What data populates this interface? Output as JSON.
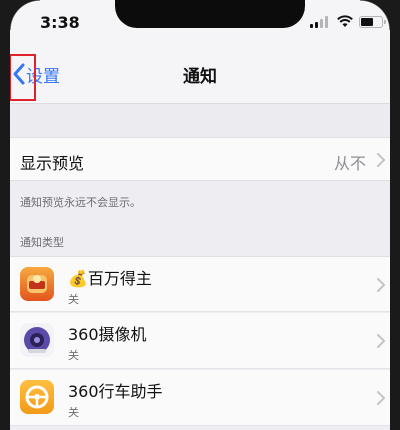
{
  "status_bar": {
    "time": "3:38"
  },
  "nav": {
    "back_label": "设置",
    "title": "通知"
  },
  "preview": {
    "label": "显示预览",
    "value": "从不",
    "footer": "通知预览永远不会显示。"
  },
  "section_header": "通知类型",
  "apps": [
    {
      "name": "💰百万得主",
      "status": "关",
      "icon": "bwdz-app-icon"
    },
    {
      "name": "360摄像机",
      "status": "关",
      "icon": "360-camera-app-icon"
    },
    {
      "name": "360行车助手",
      "status": "关",
      "icon": "360-driving-assistant-app-icon"
    }
  ],
  "colors": {
    "accent": "#3478f6",
    "highlight": "#e0232a",
    "background": "#eeeef2"
  }
}
